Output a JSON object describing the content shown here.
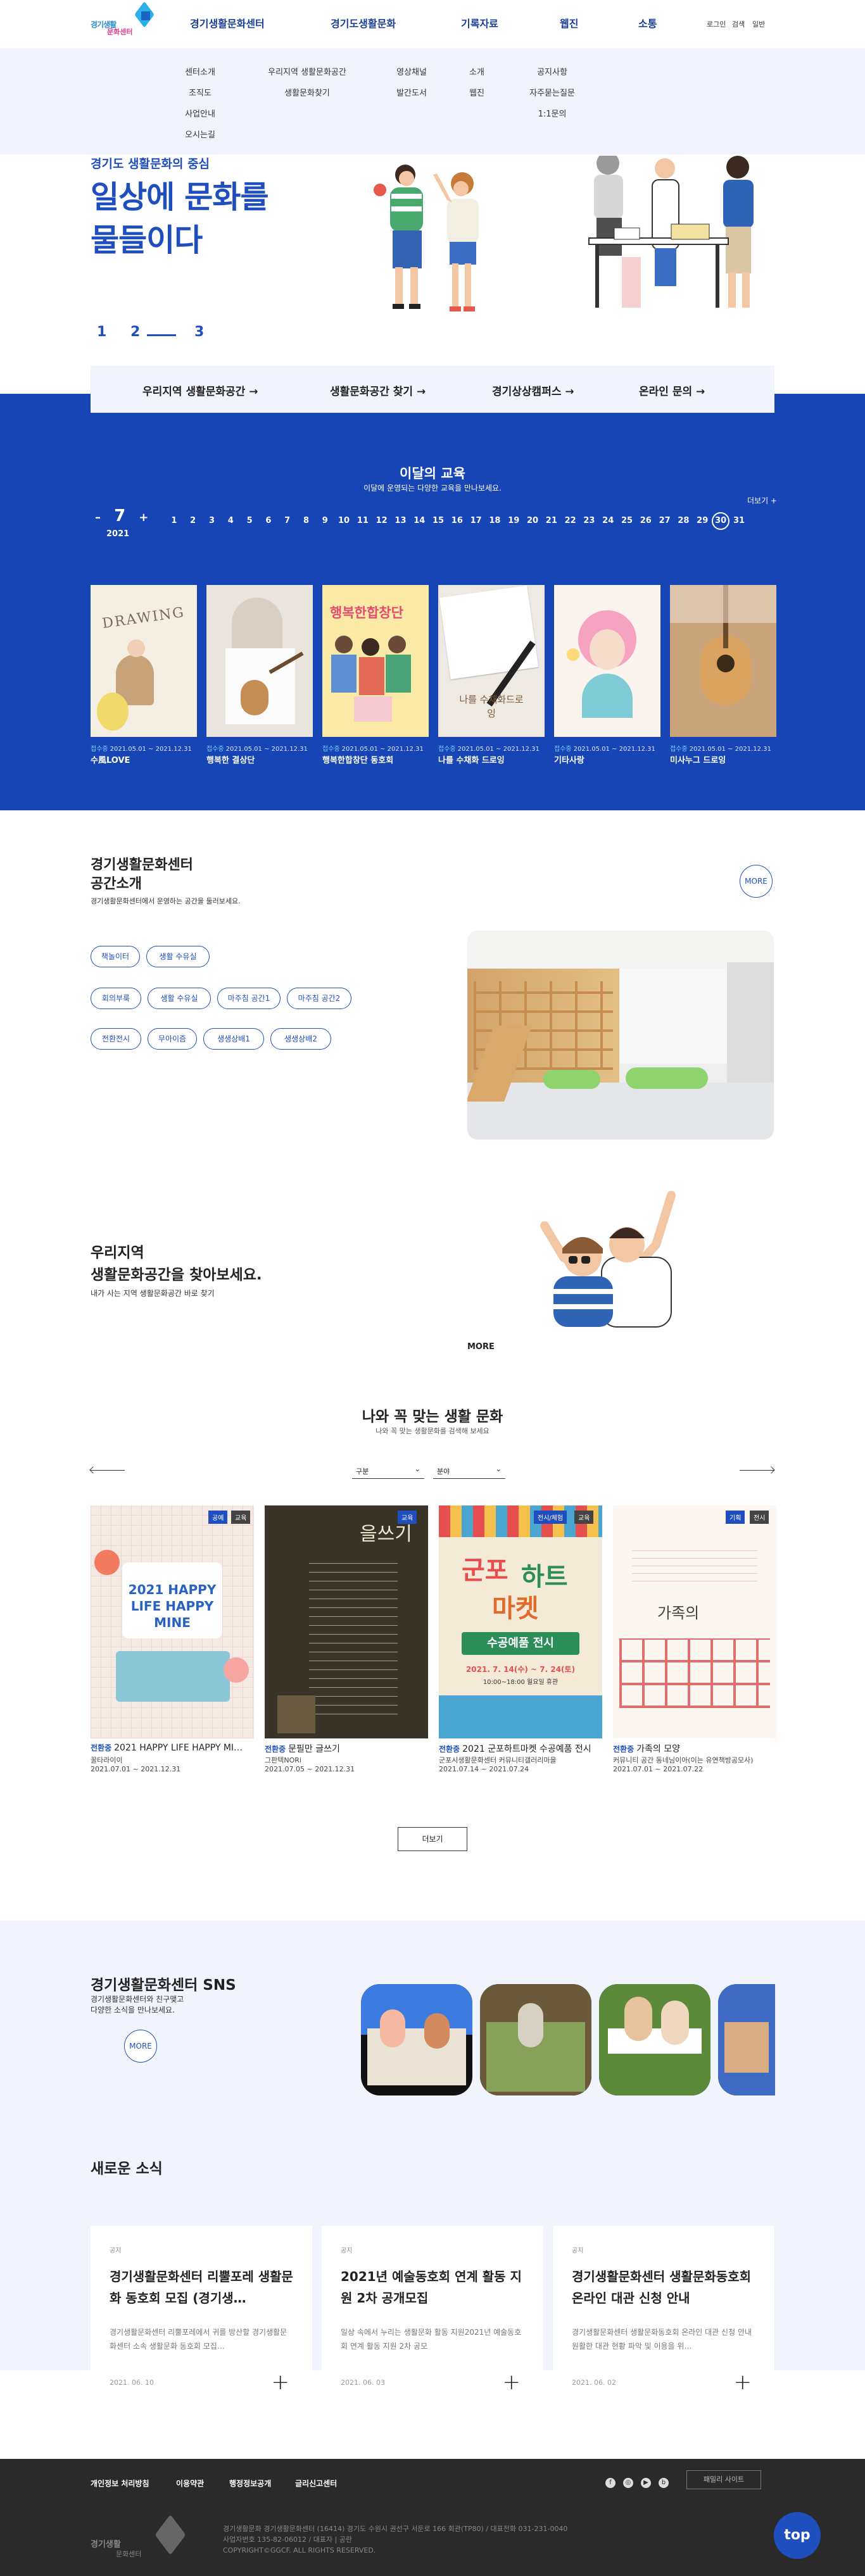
{
  "header": {
    "logo_text_1": "경기생활",
    "logo_text_2": "문화센터",
    "gnb": [
      "경기생활문화센터",
      "경기도생활문화",
      "기록자료",
      "웹진",
      "소통"
    ],
    "util": [
      "로그인",
      "검색",
      "일반"
    ]
  },
  "mega": {
    "col1": [
      "센터소개",
      "조직도",
      "사업안내",
      "오시는길"
    ],
    "col2": [
      "우리지역 생활문화공간",
      "생활문화찾기"
    ],
    "col3": [
      "영상채널",
      "발간도서"
    ],
    "col4": [
      "소개",
      "웹진"
    ],
    "col5": [
      "공지사항",
      "자주묻는질문",
      "1:1문의"
    ]
  },
  "hero": {
    "subtitle": "경기도 생활문화의 중심",
    "title_1": "일상에 문화를",
    "title_2": "물들이다",
    "pager": [
      "1",
      "2",
      "3"
    ]
  },
  "quick": [
    "우리지역 생활문화공간 →",
    "생활문화공간 찾기 →",
    "경기상상캠퍼스 →",
    "온라인 문의 →"
  ],
  "edu": {
    "title": "이달의 교육",
    "subtitle": "이달에 운영되는 다양한 교육을 만나보세요.",
    "more": "더보기 +",
    "month": "7",
    "year": "2021",
    "prev": "–",
    "next": "+",
    "days": [
      "1",
      "2",
      "3",
      "4",
      "5",
      "6",
      "7",
      "8",
      "9",
      "10",
      "11",
      "12",
      "13",
      "14",
      "15",
      "16",
      "17",
      "18",
      "19",
      "20",
      "21",
      "22",
      "23",
      "24",
      "25",
      "26",
      "27",
      "28",
      "29",
      "30",
      "31"
    ],
    "selected_day": "30",
    "cards": [
      {
        "label": "접수중",
        "date": "2021.05.01 ~ 2021.12.31",
        "name": "수風LOVE"
      },
      {
        "label": "접수중",
        "date": "2021.05.01 ~ 2021.12.31",
        "name": "행복한 결상단"
      },
      {
        "label": "접수중",
        "date": "2021.05.01 ~ 2021.12.31",
        "name": "행복한합창단 동호회"
      },
      {
        "label": "접수중",
        "date": "2021.05.01 ~ 2021.12.31",
        "name": "나를 수채화 드로잉"
      },
      {
        "label": "접수중",
        "date": "2021.05.01 ~ 2021.12.31",
        "name": "기타사랑"
      },
      {
        "label": "접수중",
        "date": "2021.05.01 ~ 2021.12.31",
        "name": "미사누그 드로잉"
      }
    ],
    "card3_poster": "행복한합창단",
    "card4_poster": "나를 수채화드로잉",
    "card1_poster": "DRAWING"
  },
  "space": {
    "title_1": "경기생활문화센터",
    "title_2": "공간소개",
    "subtitle": "경기생활문화센터에서 운영하는 공간을 둘러보세요.",
    "more": "MORE",
    "tags": [
      "책놀이터",
      "생활 수유실",
      "회의부룩",
      "생활 수유실",
      "마주침 공간1",
      "마주침 공간2",
      "전환전시",
      "무아이즘",
      "생생상배1",
      "생생상배2"
    ]
  },
  "region": {
    "title_1": "우리지역",
    "title_2": "생활문화공간을 찾아보세요.",
    "subtitle": "내가 사는 지역 생활문화공간 바로 찾기",
    "more": "MORE"
  },
  "fit": {
    "title": "나와 꼭 맞는 생활 문화",
    "subtitle": "나와 꼭 맞는 생활문화를 검색해 보세요",
    "select1": "구분",
    "select2": "분야",
    "load_more": "더보기",
    "programs": [
      {
        "badge": "전환중",
        "title": "2021 HAPPY LIFE HAPPY MI…",
        "place": "꿀타라이이",
        "date": "2021.07.01 ~ 2021.12.31",
        "poster": "2021 HAPPY LIFE HAPPY MINE",
        "tags": [
          "공예",
          "교육"
        ]
      },
      {
        "badge": "전환중",
        "title": "문필만 글쓰기",
        "place": "그판텍NORi",
        "date": "2021.07.05 ~ 2021.12.31",
        "poster": "을쓰기",
        "tags": [
          "교육"
        ]
      },
      {
        "badge": "전환중",
        "title": "2021 군포하트마켓 수공예품 전시",
        "place": "군포시생활문화센터 커뮤니티갤러리마을",
        "date": "2021.07.14 ~ 2021.07.24",
        "poster_1": "군포",
        "poster_2": "하트",
        "poster_3": "마켓",
        "poster_4": "수공예품 전시",
        "poster_5": "2021. 7. 14(수) ~ 7. 24(토)",
        "poster_6": "10:00~18:00 월요일 휴관",
        "tags": [
          "전시/체험",
          "교육"
        ]
      },
      {
        "badge": "전환중",
        "title": "가족의 모양",
        "place": "커뮤니티 공간 동네님이아(이는 유연책방공모사)",
        "date": "2021.07.01 ~ 2021.07.22",
        "poster": "가족의",
        "tags": [
          "기획",
          "전시"
        ]
      }
    ]
  },
  "sns": {
    "title": "경기생활문화센터 SNS",
    "subtitle_1": "경기생활문화센터와 친구맺고",
    "subtitle_2": "다양한 소식을 만나보세요.",
    "more": "MORE"
  },
  "news": {
    "title": "새로운 소식",
    "items": [
      {
        "kind": "공지",
        "title": "경기생활문화센터 리뿔포레 생활문화 동호회 모집 (경기생…",
        "body": "경기생활문화센터 리뿔포레에서 귀를 방산할 경기생활문화센터 소속 생활문화 동호회 모집…",
        "date": "2021. 06. 10"
      },
      {
        "kind": "공지",
        "title": "2021년 예술동호회 연계 활동 지원 2차 공개모집",
        "body": "일상 속에서 누리는 생활문화 활동 지원2021년 예술동호회 연계 활동 지원 2차 공모",
        "date": "2021. 06. 03"
      },
      {
        "kind": "공지",
        "title": "경기생활문화센터 생활문화동호회 온라인 대관 신청 안내",
        "body": "경기생활문화센터 생활문화동호회 온라인 대관 신청 안내 원활한 대관 현황 파악 및 이용을 위…",
        "date": "2021. 06. 02"
      }
    ]
  },
  "footer": {
    "links": [
      "개인정보 처리방침",
      "이용약관",
      "행정정보공개",
      "글리신고센터"
    ],
    "family_site": "패밀리 사이트",
    "info_1": "경기생활문화 경기생활문화센터 (16414) 경기도 수원시 권선구 서둔로 166 회관(TP80) / 대표전화 031-231-0040",
    "info_2": "사업자번호 135-82-06012 / 대표자 | 공란",
    "info_3": "COPYRIGHT©GGCF. ALL RIGHTS RESERVED.",
    "top": "top"
  }
}
